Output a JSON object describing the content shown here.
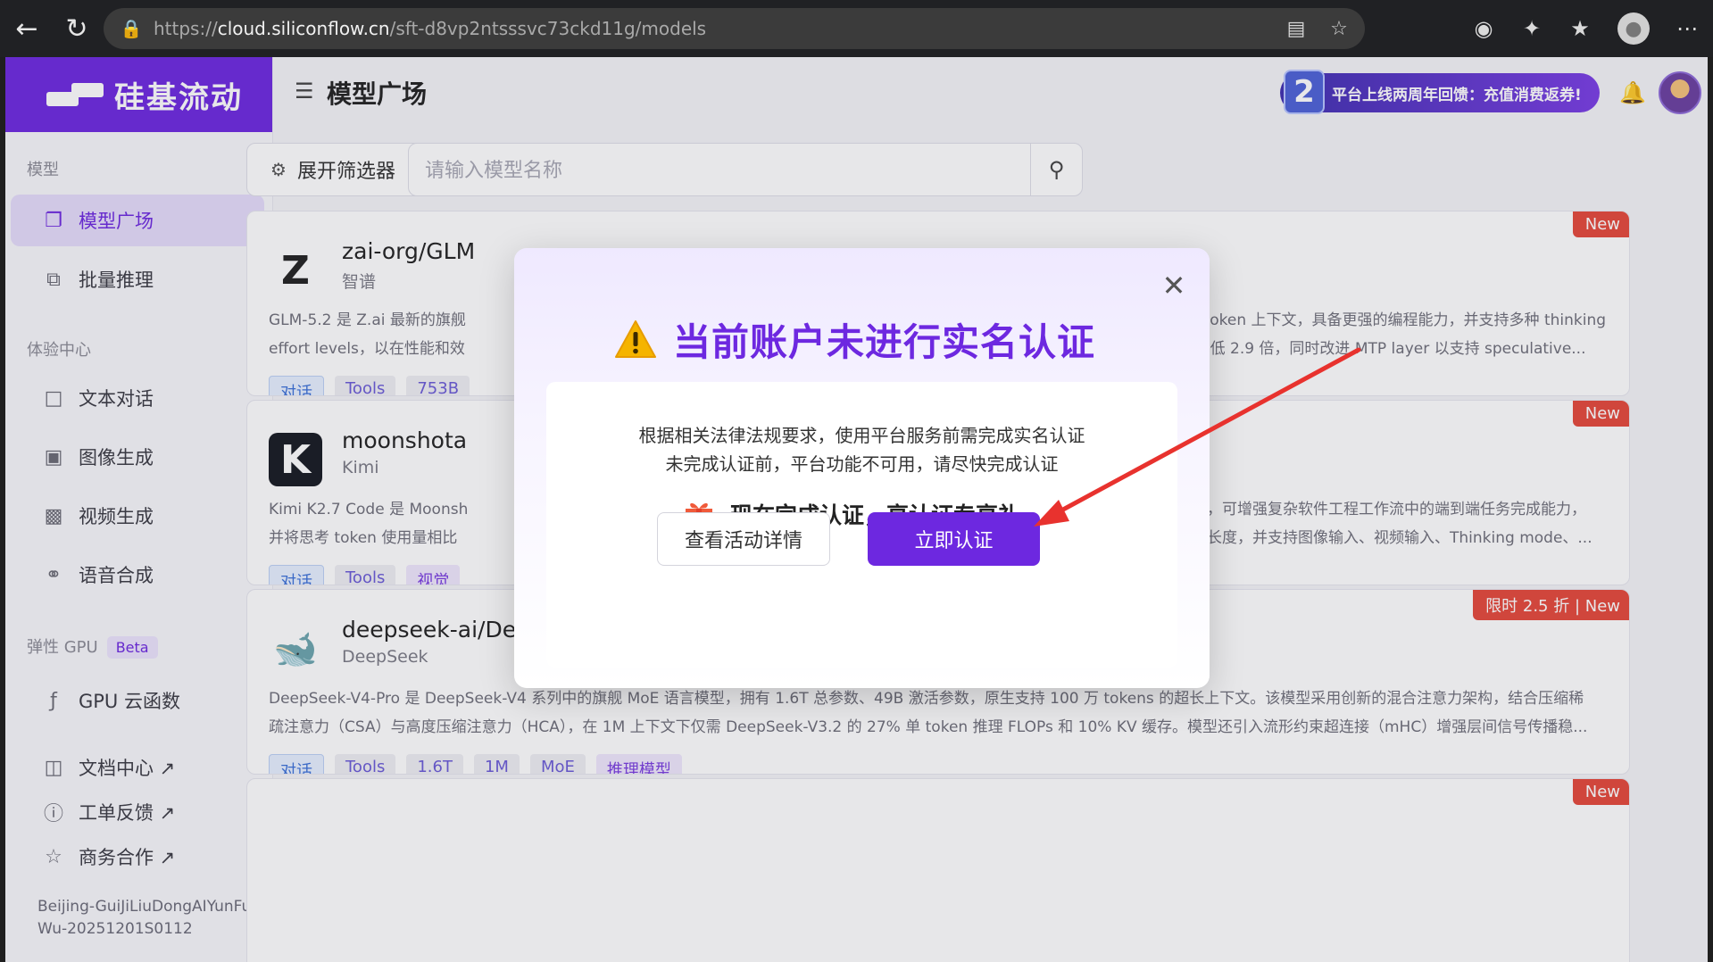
{
  "browser": {
    "url_prefix": "https://",
    "url_host": "cloud.siliconflow.cn",
    "url_path": "/sft-d8vp2ntsssvc73ckd11g/models",
    "icons": [
      "back-icon",
      "refresh-icon",
      "lock-icon",
      "reader-icon",
      "star-icon",
      "extension-icon",
      "puzzle-icon",
      "favorites-icon",
      "profile-icon",
      "more-icon"
    ]
  },
  "brand": {
    "name": "硅基流动",
    "color": "#6d28e0"
  },
  "sidebar": {
    "section_models": "模型",
    "item_square": "模型广场",
    "item_batch": "批量推理",
    "section_experience": "体验中心",
    "item_text": "文本对话",
    "item_image": "图像生成",
    "item_video": "视频生成",
    "item_voice": "语音合成",
    "section_gpu": "弹性 GPU",
    "gpu_badge": "Beta",
    "item_gpu": "GPU 云函数",
    "item_docs": "文档中心 ↗",
    "item_ticket": "工单反馈 ↗",
    "item_biz": "商务合作 ↗",
    "footer_line1": "Beijing-GuiJiLiuDongAIYunFu",
    "footer_line2": "Wu-20251201S0112"
  },
  "header": {
    "title": "模型广场",
    "promo_num": "2",
    "promo_text": "平台上线两周年回馈：充值消费返券!"
  },
  "toolbar": {
    "filter_label": "展开筛选器",
    "search_placeholder": "请输入模型名称"
  },
  "cards": [
    {
      "name": "zai-org/GLM",
      "org": "智谱",
      "badge": "New",
      "desc_left1": "GLM-5.2 是 Z.ai 最新的旗舰",
      "desc_left2": "effort levels，以在性能和效",
      "desc_right1": "1M-token 上下文，具备更强的编程能力，并支持多种 thinking",
      "desc_right2": "OPs 降低 2.9 倍，同时改进 MTP layer 以支持 speculative...",
      "tags": [
        "对话",
        "Tools",
        "753B"
      ]
    },
    {
      "name": "moonshota",
      "org": "Kimi",
      "badge": "New",
      "desc_left1": "Kimi K2.7 Code 是 Moonsh",
      "desc_left2": "并将思考 token 使用量相比",
      "desc_right1": "著提升，可增强复杂软件工程工作流中的端到端任务完成能力，",
      "desc_right2": "上下文长度，并支持图像输入、视频输入、Thinking mode、...",
      "tags": [
        "对话",
        "Tools",
        "视觉"
      ]
    },
    {
      "name": "deepseek-ai/DeepSeek-V4-Pro",
      "org": "DeepSeek",
      "badge": "限时 2.5 折 | New",
      "desc1": "DeepSeek-V4-Pro 是 DeepSeek-V4 系列中的旗舰 MoE 语言模型，拥有 1.6T 总参数、49B 激活参数，原生支持 100 万 tokens 的超长上下文。该模型采用创新的混合注意力架构，结合压缩稀",
      "desc2": "疏注意力（CSA）与高度压缩注意力（HCA），在 1M 上下文下仅需 DeepSeek-V3.2 的 27% 单 token 推理 FLOPs 和 10% KV 缓存。模型还引入流形约束超连接（mHC）增强层间信号传播稳...",
      "tags": [
        "对话",
        "Tools",
        "1.6T",
        "1M",
        "MoE",
        "推理模型"
      ]
    },
    {
      "badge": "New"
    }
  ],
  "modal": {
    "title": "当前账户未进行实名认证",
    "msg_line1": "根据相关法律法规要求，使用平台服务前需完成实名认证",
    "msg_line2": "未完成认证前，平台功能不可用，请尽快完成认证",
    "gift_msg": "现在完成认证，享认证专享礼",
    "btn_detail": "查看活动详情",
    "btn_verify": "立即认证"
  }
}
